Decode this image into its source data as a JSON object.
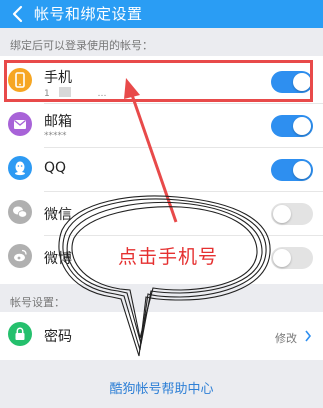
{
  "header": {
    "title": "帐号和绑定设置"
  },
  "bind_section": {
    "label": "绑定后可以登录使用的帐号：",
    "items": [
      {
        "name": "手机",
        "sub": "1",
        "sub_mask": "…",
        "icon": "phone-icon",
        "enabled": true,
        "icon_color": "#f6a623"
      },
      {
        "name": "邮箱",
        "sub": "*****",
        "icon": "mail-icon",
        "enabled": true,
        "icon_color": "#a863d8"
      },
      {
        "name": "QQ",
        "icon": "qq-icon",
        "enabled": true,
        "icon_color": "#2d9af3"
      },
      {
        "name": "微信",
        "icon": "wechat-icon",
        "enabled": false,
        "icon_color": "#b0b0b0"
      },
      {
        "name": "微博",
        "icon": "weibo-icon",
        "enabled": false,
        "icon_color": "#b0b0b0"
      }
    ]
  },
  "account_section": {
    "label": "帐号设置：",
    "password": {
      "name": "密码",
      "action": "修改",
      "icon": "lock-icon",
      "icon_color": "#25c06d"
    }
  },
  "help_link": "酷狗帐号帮助中心",
  "annotation": {
    "callout": "点击手机号",
    "color": "#e84a4a"
  },
  "colors": {
    "header": "#2a9df4",
    "toggle_on": "#2e8ff0",
    "toggle_off": "#e3e3e3",
    "link": "#2f80d6"
  }
}
